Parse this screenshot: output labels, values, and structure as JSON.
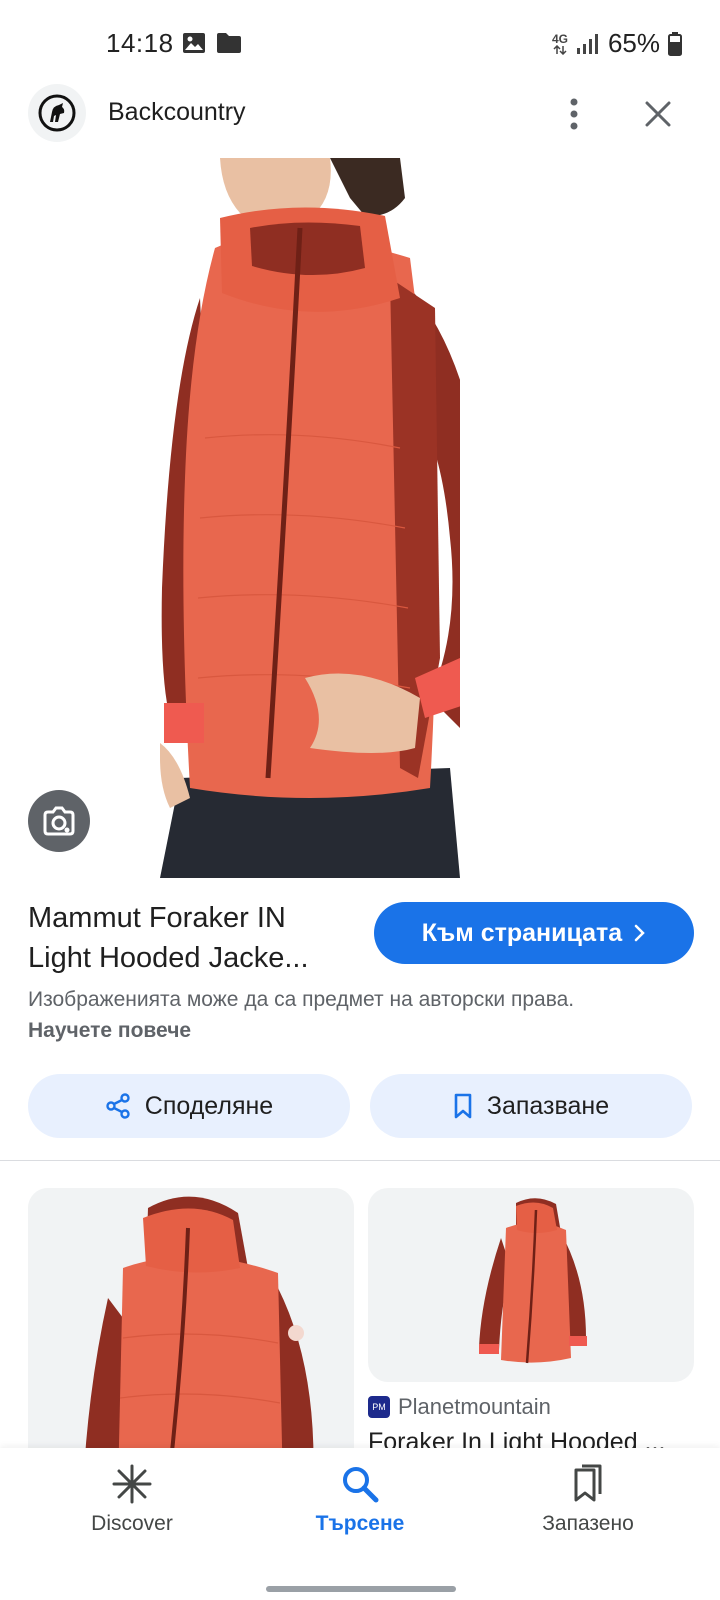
{
  "status_bar": {
    "time": "14:18",
    "network_label": "4G",
    "battery_percent": "65%"
  },
  "header": {
    "site_name": "Backcountry",
    "logo_icon": "goat-logo-icon",
    "more_icon": "more-vert-icon",
    "close_icon": "close-icon"
  },
  "product": {
    "title": "Mammut Foraker IN Light Hooded Jacke...",
    "visit_label": "Към страницата",
    "copyright_text": "Изображенията може да са предмет на авторски права.",
    "learn_more_label": "Научете повече"
  },
  "actions": {
    "share_label": "Споделяне",
    "save_label": "Запазване"
  },
  "related": {
    "right_card": {
      "source_name": "Planetmountain",
      "favicon_text": "PM",
      "title": "Foraker In Light Hooded ..."
    }
  },
  "bottom_nav": {
    "items": [
      {
        "label": "Discover",
        "icon": "asterisk-icon",
        "active": false
      },
      {
        "label": "Търсене",
        "icon": "search-icon",
        "active": true
      },
      {
        "label": "Запазено",
        "icon": "saved-icon",
        "active": false
      }
    ]
  },
  "colors": {
    "accent": "#1a73e8",
    "chip_bg": "#e8f0fe",
    "jacket_main": "#e8674e",
    "jacket_sleeve": "#8f2e22"
  }
}
